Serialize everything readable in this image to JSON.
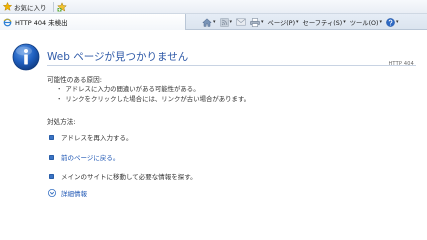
{
  "favorites_bar": {
    "favorites_label": "お気に入り"
  },
  "tab": {
    "title": "HTTP 404 未検出"
  },
  "command_bar": {
    "page_label": "ページ(P)",
    "safety_label": "セーフティ(S)",
    "tools_label": "ツール(O)"
  },
  "page": {
    "title": "Web ページが見つかりません",
    "http_code": "HTTP 404",
    "causes_heading": "可能性のある原因:",
    "causes": [
      "アドレスに入力の間違いがある可能性がある。",
      "リンクをクリックした場合には、リンクが古い場合があります。"
    ],
    "solutions_heading": "対処方法:",
    "solutions": [
      "アドレスを再入力する。",
      "前のページに戻る。",
      "メインのサイトに移動して必要な情報を探す。"
    ],
    "more_info": "詳細情報"
  },
  "colors": {
    "accent_blue": "#2f5aa8",
    "link_blue": "#1f57b5",
    "bullet_blue": "#3a73c4"
  }
}
